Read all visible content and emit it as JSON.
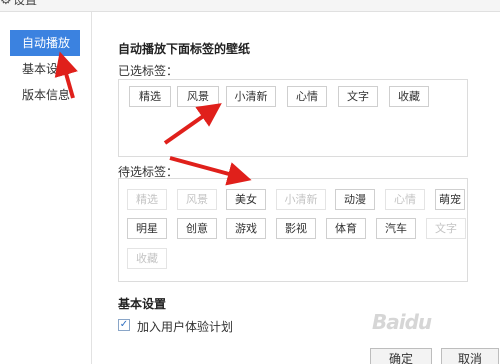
{
  "window": {
    "title": "设置",
    "icon": "gear-icon"
  },
  "sidebar": {
    "items": [
      {
        "label": "自动播放",
        "active": true
      },
      {
        "label": "基本设置",
        "active": false
      },
      {
        "label": "版本信息",
        "active": false
      }
    ]
  },
  "main": {
    "section_title": "自动播放下面标签的壁纸",
    "selected_label": "已选标签：",
    "selected_tags": [
      "精选",
      "风景",
      "小清新",
      "心情",
      "文字",
      "收藏"
    ],
    "candidate_label": "待选标签：",
    "candidate_tags": [
      {
        "label": "精选",
        "disabled": true
      },
      {
        "label": "风景",
        "disabled": true
      },
      {
        "label": "美女",
        "disabled": false
      },
      {
        "label": "小清新",
        "disabled": true
      },
      {
        "label": "动漫",
        "disabled": false
      },
      {
        "label": "心情",
        "disabled": true
      },
      {
        "label": "萌宠",
        "disabled": false
      },
      {
        "label": "明星",
        "disabled": false
      },
      {
        "label": "创意",
        "disabled": false
      },
      {
        "label": "游戏",
        "disabled": false
      },
      {
        "label": "影视",
        "disabled": false
      },
      {
        "label": "体育",
        "disabled": false
      },
      {
        "label": "汽车",
        "disabled": false
      },
      {
        "label": "文字",
        "disabled": true
      },
      {
        "label": "收藏",
        "disabled": true
      }
    ],
    "basic_settings_title": "基本设置",
    "join_program_label": "加入用户体验计划",
    "join_program_checked": true
  },
  "footer": {
    "ok_label": "确定",
    "cancel_label": "取消"
  },
  "watermark": "Baidu",
  "colors": {
    "accent": "#3b82e0",
    "arrow": "#e0201b"
  }
}
